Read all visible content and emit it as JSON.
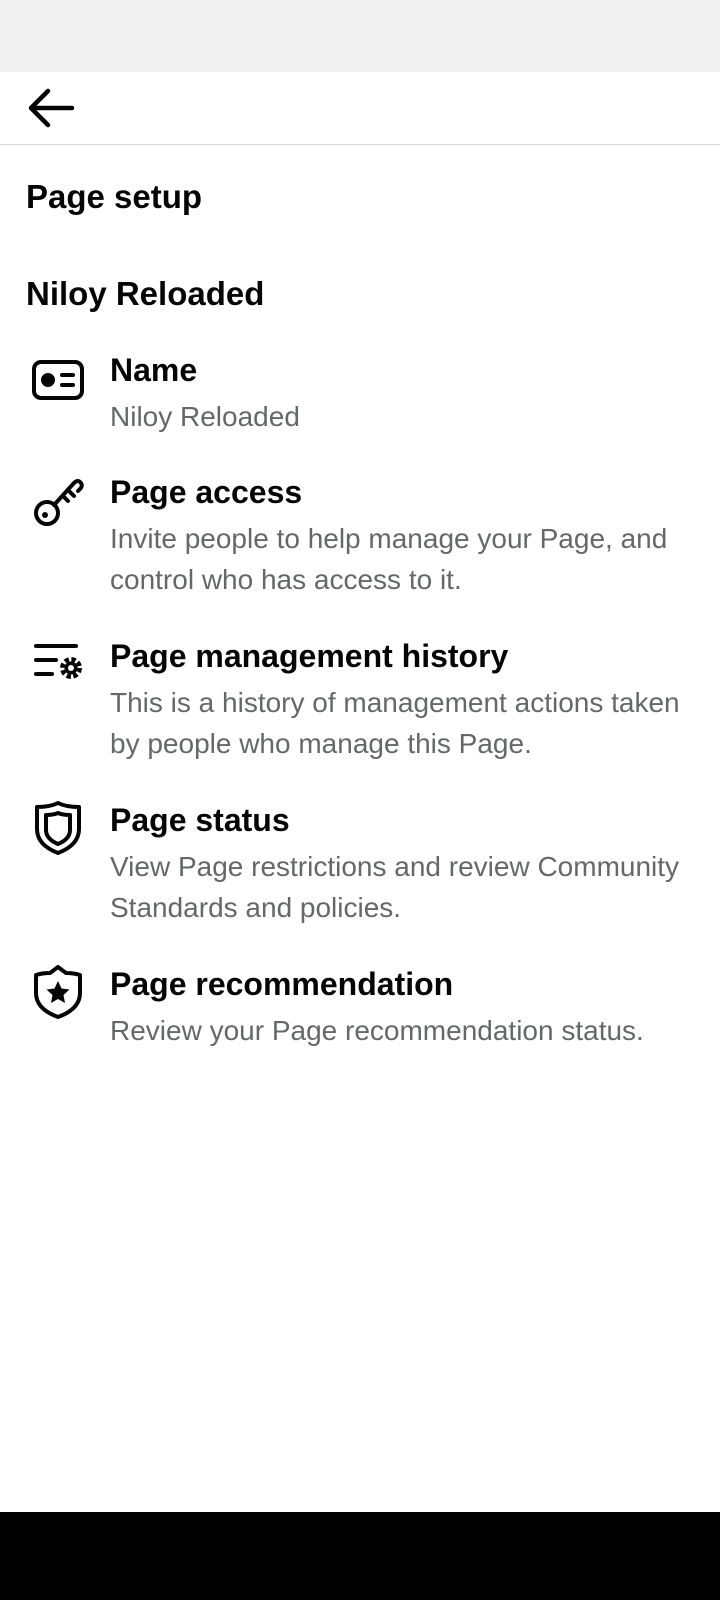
{
  "header": {
    "back_icon": "arrow-left-icon"
  },
  "page": {
    "title": "Page setup",
    "name_heading": "Niloy Reloaded"
  },
  "items": [
    {
      "icon": "id-card-icon",
      "title": "Name",
      "description": "Niloy Reloaded"
    },
    {
      "icon": "key-icon",
      "title": "Page access",
      "description": "Invite people to help manage your Page, and control who has access to it."
    },
    {
      "icon": "list-settings-icon",
      "title": "Page management history",
      "description": "This is a history of management actions taken by people who manage this Page."
    },
    {
      "icon": "shield-icon",
      "title": "Page status",
      "description": "View Page restrictions and review Community Standards and policies."
    },
    {
      "icon": "shield-star-icon",
      "title": "Page recommendation",
      "description": "Review your Page recommendation status."
    }
  ]
}
